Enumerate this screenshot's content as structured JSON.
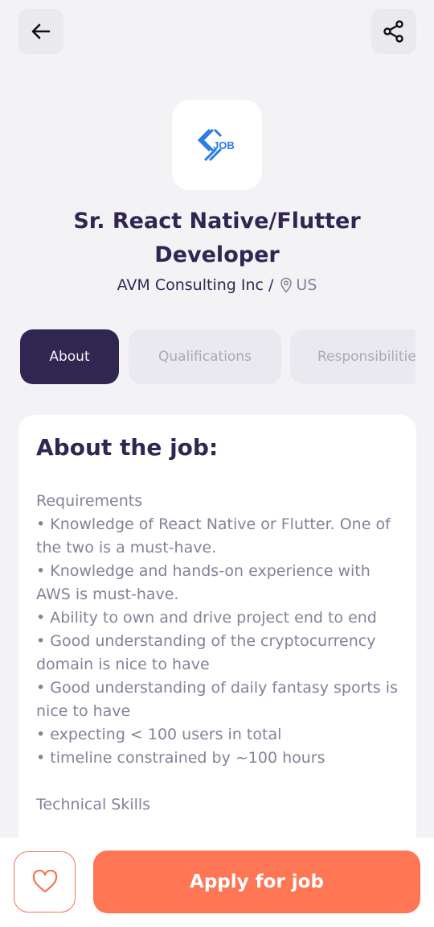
{
  "header": {
    "back_icon": "arrow-left-icon",
    "share_icon": "share-icon"
  },
  "logo": {
    "text": "JOB",
    "color": "#2a7be4"
  },
  "job": {
    "title": "Sr. React Native/Flutter Developer",
    "company": "AVM Consulting Inc /",
    "location": "US"
  },
  "tabs": [
    {
      "label": "About",
      "active": true
    },
    {
      "label": "Qualifications",
      "active": false
    },
    {
      "label": "Responsibilities",
      "active": false
    }
  ],
  "about": {
    "heading": "About the job:",
    "description": "Requirements\n• Knowledge of React Native or Flutter. One of the two is a must-have.\n• Knowledge and hands-on experience with AWS is must-have.\n• Ability to own and drive project end to end\n• Good understanding of the cryptocurrency domain is nice to have\n• Good understanding of daily fantasy sports is nice to have\n• expecting < 100 users in total\n• timeline constrained by ~100 hours\n\nTechnical Skills"
  },
  "footer": {
    "like_icon": "heart-icon",
    "apply_label": "Apply for job"
  },
  "colors": {
    "primary": "#312651",
    "accent": "#fe7654",
    "gray": "#83829a",
    "background": "#f3f3f6"
  }
}
